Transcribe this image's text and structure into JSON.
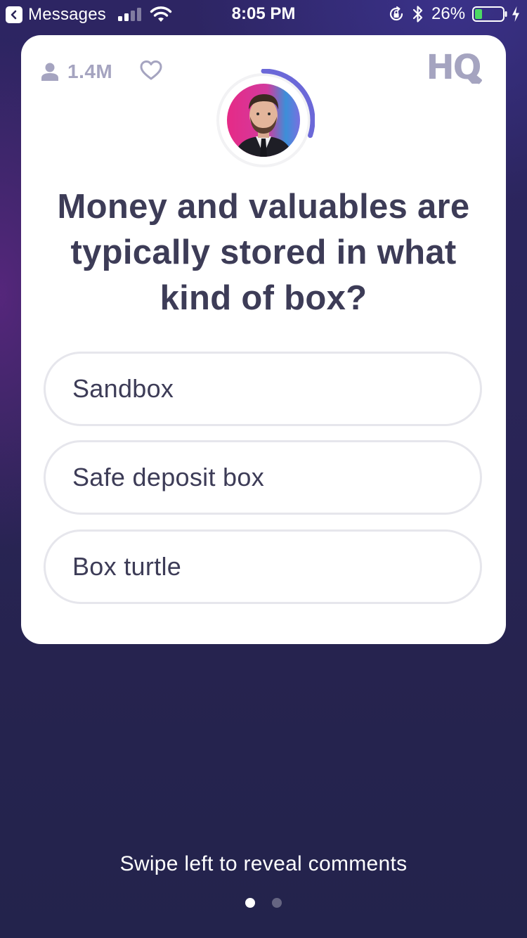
{
  "status_bar": {
    "back_app": "Messages",
    "time": "8:05 PM",
    "battery_percent": "26%",
    "battery_level": 0.26,
    "icons": [
      "back-chevron-icon",
      "signal-icon",
      "wifi-icon",
      "rotation-lock-icon",
      "bluetooth-icon",
      "battery-icon",
      "charging-icon"
    ]
  },
  "card": {
    "viewers": "1.4M",
    "logo": "HQ",
    "question": "Money and valuables are typically stored in what kind of box?",
    "answers": [
      {
        "label": "Sandbox"
      },
      {
        "label": "Safe deposit box"
      },
      {
        "label": "Box turtle"
      }
    ],
    "timer_progress": 0.3,
    "icons": [
      "user-icon",
      "heart-icon",
      "host-avatar"
    ]
  },
  "footer": {
    "swipe_hint": "Swipe left to reveal comments",
    "pages": 2,
    "active_page": 1
  },
  "colors": {
    "accent": "#6b68d8",
    "text_dark": "#3d3c57",
    "muted": "#a5a4c0",
    "card_bg": "#ffffff",
    "battery_green": "#4cd964"
  }
}
